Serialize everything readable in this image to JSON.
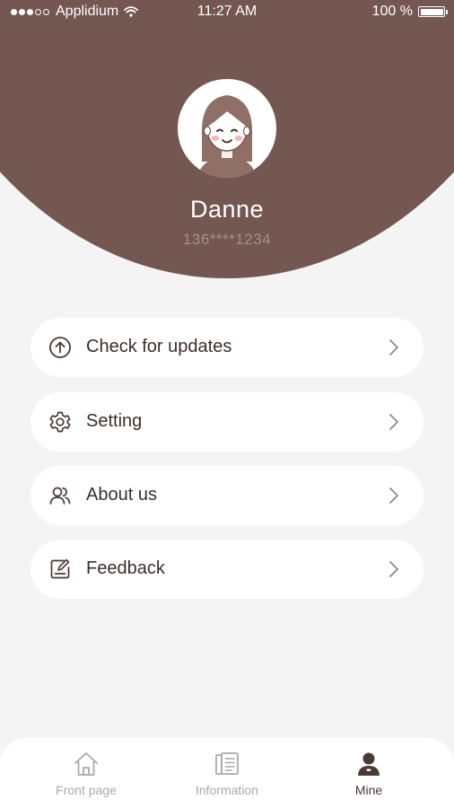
{
  "status_bar": {
    "carrier": "Applidium",
    "time": "11:27 AM",
    "battery": "100 %",
    "battery_level": 1.0
  },
  "profile": {
    "name": "Danne",
    "phone": "136****1234",
    "avatar_icon": "girl-avatar-icon"
  },
  "menu": {
    "items": [
      {
        "label": "Check for updates",
        "icon": "arrow-up-circle-icon"
      },
      {
        "label": "Setting",
        "icon": "gear-icon"
      },
      {
        "label": "About us",
        "icon": "users-icon"
      },
      {
        "label": "Feedback",
        "icon": "edit-note-icon"
      }
    ]
  },
  "tabbar": {
    "tabs": [
      {
        "label": "Front page",
        "icon": "home-icon",
        "active": false
      },
      {
        "label": "Information",
        "icon": "news-icon",
        "active": false
      },
      {
        "label": "Mine",
        "icon": "person-icon",
        "active": true
      }
    ]
  },
  "colors": {
    "brand": "#735750",
    "background": "#f4f4f4",
    "card": "#ffffff",
    "text": "#3a2e2b",
    "tab_inactive": "#a9a9a9"
  }
}
